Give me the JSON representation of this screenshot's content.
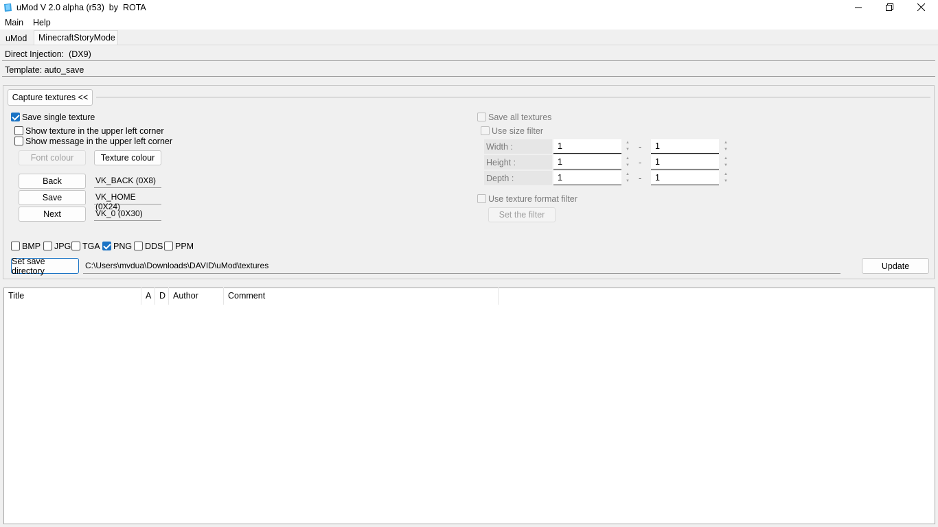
{
  "window": {
    "title": "uMod V 2.0 alpha (r53)  by  ROTA",
    "controls": {
      "minimize": "minimize-icon",
      "maximize": "maximize-icon",
      "close": "close-icon"
    }
  },
  "menu": {
    "items": [
      "Main",
      "Help"
    ]
  },
  "tabs": [
    {
      "label": "uMod",
      "active": false
    },
    {
      "label": "MinecraftStoryMode",
      "active": true
    }
  ],
  "info": {
    "direct_injection": "Direct Injection:  (DX9)",
    "template": "Template: auto_save"
  },
  "capture": {
    "toggle_label": "Capture textures <<",
    "save_single": {
      "label": "Save single texture",
      "checked": true
    },
    "show_texture": {
      "label": "Show texture in the upper left corner",
      "checked": false
    },
    "show_message": {
      "label": "Show message in the upper left corner",
      "checked": false
    },
    "font_colour_label": "Font colour",
    "texture_colour_label": "Texture colour",
    "keys": [
      {
        "button": "Back",
        "value": "VK_BACK (0X8)"
      },
      {
        "button": "Save",
        "value": "VK_HOME (0X24)"
      },
      {
        "button": "Next",
        "value": "VK_0 (0X30)"
      }
    ],
    "save_all": {
      "label": "Save all textures",
      "checked": false
    },
    "size_filter": {
      "label": "Use size filter",
      "checked": false
    },
    "dims": [
      {
        "label": "Width :",
        "min": "1",
        "max": "1"
      },
      {
        "label": "Height :",
        "min": "1",
        "max": "1"
      },
      {
        "label": "Depth :",
        "min": "1",
        "max": "1"
      }
    ],
    "dash": "-",
    "format_filter": {
      "label": "Use texture format filter",
      "checked": false
    },
    "set_filter_label": "Set the filter",
    "formats": [
      {
        "label": "BMP",
        "checked": false
      },
      {
        "label": "JPG",
        "checked": false
      },
      {
        "label": "TGA",
        "checked": false
      },
      {
        "label": "PNG",
        "checked": true
      },
      {
        "label": "DDS",
        "checked": false
      },
      {
        "label": "PPM",
        "checked": false
      }
    ],
    "set_dir_label": "Set save directory",
    "save_dir": "C:\\Users\\mvdua\\Downloads\\DAVID\\uMod\\textures",
    "update_label": "Update"
  },
  "table": {
    "columns": [
      "Title",
      "A",
      "D",
      "Author",
      "Comment"
    ]
  },
  "colors": {
    "accent": "#1a73c4",
    "window_bg": "#f0f0f0"
  }
}
